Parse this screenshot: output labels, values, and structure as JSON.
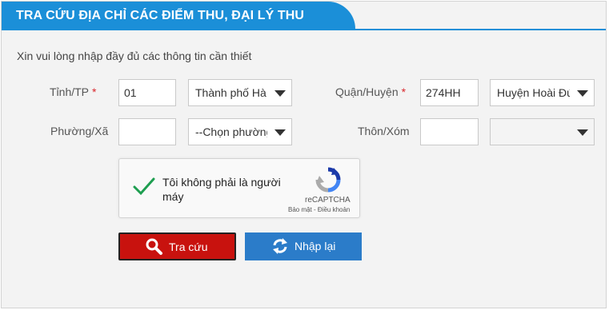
{
  "header": {
    "title": "TRA CỨU ĐỊA CHỈ CÁC ĐIỂM THU, ĐẠI LÝ THU"
  },
  "intro": "Xin vui lòng nhập đầy đủ các thông tin cần thiết",
  "required_mark": "*",
  "province": {
    "label": "Tỉnh/TP",
    "code": "01",
    "selected": "Thành phố Hà Nội"
  },
  "district": {
    "label": "Quận/Huyện",
    "code": "274HH",
    "selected": "Huyện Hoài Đức"
  },
  "ward": {
    "label": "Phường/Xã",
    "code": "",
    "selected": "--Chọn phường/xã--"
  },
  "village": {
    "label": "Thôn/Xóm",
    "code": "",
    "selected": ""
  },
  "captcha": {
    "text": "Tôi không phải là người máy",
    "brand": "reCAPTCHA",
    "links": "Bảo mật - Điều khoản",
    "checked": true
  },
  "buttons": {
    "search": "Tra cứu",
    "reset": "Nhập lại"
  },
  "colors": {
    "header_blue": "#1b8fd8",
    "search_red": "#c8120e",
    "reset_blue": "#2b7cc9",
    "check_green": "#1e9e50"
  }
}
